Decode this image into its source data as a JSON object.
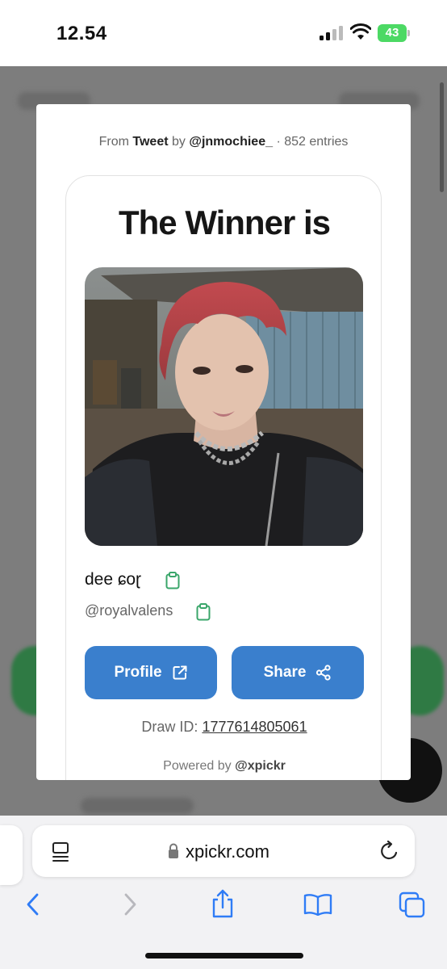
{
  "status_bar": {
    "time": "12.54",
    "battery": "43"
  },
  "modal": {
    "source": {
      "from": "From",
      "source_name": "Tweet",
      "by": "by",
      "author": "@jnmochiee_",
      "entries": "· 852 entries"
    },
    "card": {
      "title": "The Winner is",
      "winner_name": "dee ɕoɽ",
      "winner_handle": "@royalvalens",
      "profile_button": "Profile",
      "share_button": "Share",
      "draw_id_label": "Draw ID:",
      "draw_id_value": "1777614805061",
      "powered_by_label": "Powered by",
      "powered_by_brand": "@xpickr"
    }
  },
  "browser": {
    "url": "xpickr.com"
  },
  "colors": {
    "accent_blue": "#3a7fcd",
    "copy_icon_green": "#3aa66a",
    "safari_blue": "#2f7cf6"
  }
}
